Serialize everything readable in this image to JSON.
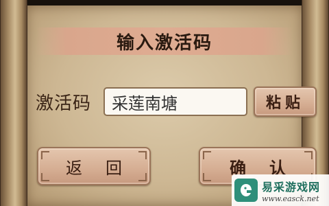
{
  "dialog": {
    "title": "输入激活码",
    "field_label": "激活码",
    "code_value": "采莲南塘",
    "paste_label": "粘贴",
    "back_label": "返回",
    "confirm_label": "确认"
  },
  "watermark": {
    "name": "易采游戏网",
    "url": "www.easck.net"
  },
  "colors": {
    "parchment": "#cdb793",
    "title_band": "#dfac92",
    "button_fill": "#d5ad92",
    "button_border": "#9a7459",
    "text_dark": "#3a2416",
    "watermark_green": "#2f8f7a"
  }
}
